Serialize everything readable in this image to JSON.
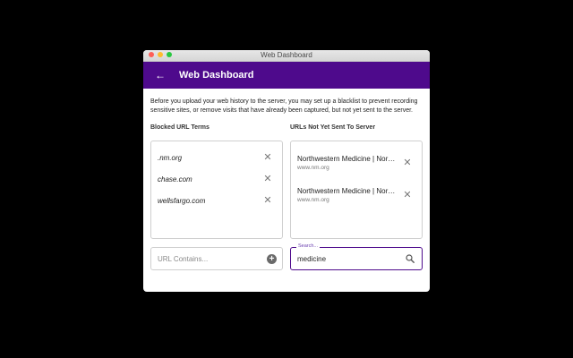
{
  "window": {
    "title": "Web Dashboard"
  },
  "appbar": {
    "back_icon": "arrow-left-icon",
    "title": "Web Dashboard"
  },
  "intro": "Before you upload your web history to the server, you may set up a blacklist to prevent recording sensitive sites, or remove visits that have already been captured, but not yet sent to the server.",
  "blocked": {
    "heading": "Blocked URL Terms",
    "items": [
      {
        "label": ".nm.org"
      },
      {
        "label": "chase.com"
      },
      {
        "label": "wellsfargo.com"
      }
    ],
    "input_placeholder": "URL Contains..."
  },
  "unsent": {
    "heading": "URLs Not Yet Sent To Server",
    "items": [
      {
        "title": "Northwestern Medicine | Northwestern Medicine",
        "domain": "www.nm.org"
      },
      {
        "title": "Northwestern Medicine | Northwestern Medicine",
        "domain": "www.nm.org"
      }
    ],
    "search_label": "Search...",
    "search_value": "medicine"
  },
  "colors": {
    "accent": "#4e0a8c"
  }
}
